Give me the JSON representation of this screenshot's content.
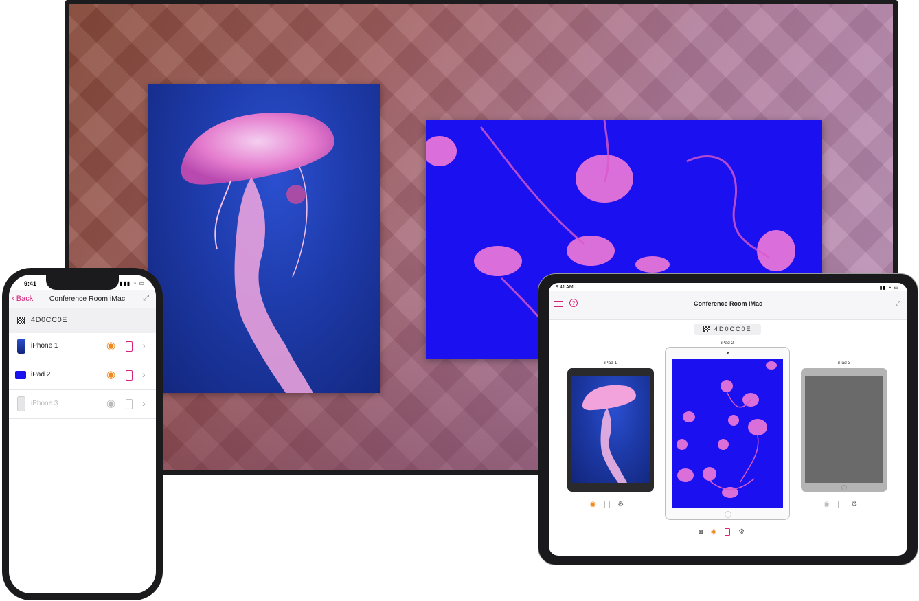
{
  "iphone": {
    "status_time": "9:41",
    "nav": {
      "back_label": "Back",
      "title": "Conference Room iMac"
    },
    "code": "4D0CC0E",
    "devices": [
      {
        "label": "iPhone 1",
        "active": true
      },
      {
        "label": "iPad 2",
        "active": true
      },
      {
        "label": "iPhone 3",
        "active": false
      }
    ]
  },
  "ipad": {
    "status_time": "9:41 AM",
    "nav": {
      "title": "Conference Room iMac"
    },
    "code": "4D0CC0E",
    "devices": [
      {
        "label": "iPad 1"
      },
      {
        "label": "iPad 2"
      },
      {
        "label": "iPad 3"
      }
    ]
  },
  "colors": {
    "accent": "#d6237a",
    "eye": "#f08a1e",
    "jelly_blue": "#1a10f0"
  },
  "icons": [
    "chevron-left-icon",
    "expand-icon",
    "qr-icon",
    "eye-icon",
    "device-icon",
    "chevron-right-icon",
    "menu-icon",
    "help-icon",
    "camera-icon",
    "gear-icon"
  ]
}
